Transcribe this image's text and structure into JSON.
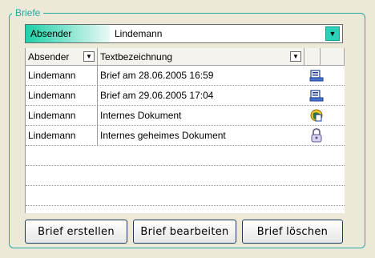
{
  "group": {
    "title": "Briefe"
  },
  "filter": {
    "label": "Absender",
    "value": "Lindemann"
  },
  "grid": {
    "headers": [
      "Absender",
      "Textbezeichnung"
    ],
    "rows": [
      {
        "absender": "Lindemann",
        "text": "Brief am 28.06.2005 16:59",
        "icon": "document-icon"
      },
      {
        "absender": "Lindemann",
        "text": "Brief am 29.06.2005 17:04",
        "icon": "document-icon"
      },
      {
        "absender": "Lindemann",
        "text": "Internes Dokument",
        "icon": "world-document-icon"
      },
      {
        "absender": "Lindemann",
        "text": "Internes geheimes Dokument",
        "icon": "lock-icon"
      }
    ]
  },
  "buttons": {
    "create": "Brief erstellen",
    "edit": "Brief bearbeiten",
    "delete": "Brief löschen"
  },
  "colors": {
    "accent": "#2aa7a0",
    "filter_gradient": "#1ed0a8"
  }
}
